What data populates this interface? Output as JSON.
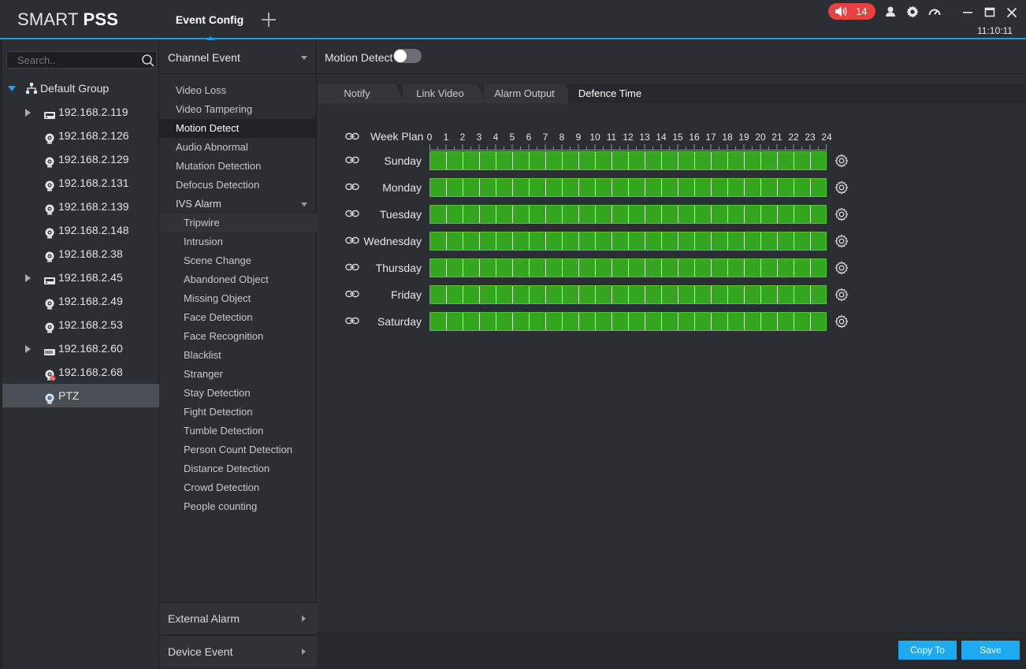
{
  "app": {
    "logo_light": "SMART",
    "logo_bold": "PSS",
    "active_tab": "Event Config",
    "alarm_count": "14",
    "clock": "11:10:11"
  },
  "search": {
    "placeholder": "Search.."
  },
  "tree": {
    "group": "Default Group",
    "devices": [
      {
        "label": "192.168.2.119",
        "type": "nvr",
        "expandable": true
      },
      {
        "label": "192.168.2.126",
        "type": "camera",
        "expandable": false
      },
      {
        "label": "192.168.2.129",
        "type": "camera",
        "expandable": false
      },
      {
        "label": "192.168.2.131",
        "type": "camera",
        "expandable": false
      },
      {
        "label": "192.168.2.139",
        "type": "camera",
        "expandable": false
      },
      {
        "label": "192.168.2.148",
        "type": "camera",
        "expandable": false
      },
      {
        "label": "192.168.2.38",
        "type": "camera",
        "expandable": false
      },
      {
        "label": "192.168.2.45",
        "type": "nvr",
        "expandable": true
      },
      {
        "label": "192.168.2.49",
        "type": "camera",
        "expandable": false
      },
      {
        "label": "192.168.2.53",
        "type": "camera",
        "expandable": false
      },
      {
        "label": "192.168.2.60",
        "type": "nvr2",
        "expandable": true
      },
      {
        "label": "192.168.2.68",
        "type": "camera-offline",
        "expandable": false
      },
      {
        "label": "PTZ",
        "type": "camera-selected",
        "expandable": false,
        "selected": true
      }
    ]
  },
  "events": {
    "header": "Channel Event",
    "items": [
      {
        "label": "Video Loss",
        "kind": "item"
      },
      {
        "label": "Video Tampering",
        "kind": "item"
      },
      {
        "label": "Motion Detect",
        "kind": "item",
        "selected": true
      },
      {
        "label": "Audio Abnormal",
        "kind": "item"
      },
      {
        "label": "Mutation Detection",
        "kind": "item"
      },
      {
        "label": "Defocus Detection",
        "kind": "item"
      },
      {
        "label": "IVS Alarm",
        "kind": "group"
      },
      {
        "label": "Tripwire",
        "kind": "sub"
      },
      {
        "label": "Intrusion",
        "kind": "sub"
      },
      {
        "label": "Scene Change",
        "kind": "sub"
      },
      {
        "label": "Abandoned Object",
        "kind": "sub"
      },
      {
        "label": "Missing Object",
        "kind": "sub"
      },
      {
        "label": "Face Detection",
        "kind": "sub"
      },
      {
        "label": "Face Recognition",
        "kind": "sub"
      },
      {
        "label": "Blacklist",
        "kind": "sub"
      },
      {
        "label": "Stranger",
        "kind": "sub"
      },
      {
        "label": "Stay Detection",
        "kind": "sub"
      },
      {
        "label": "Fight Detection",
        "kind": "sub"
      },
      {
        "label": "Tumble Detection",
        "kind": "sub"
      },
      {
        "label": "Person Count Detection",
        "kind": "sub"
      },
      {
        "label": "Distance Detection",
        "kind": "sub"
      },
      {
        "label": "Crowd Detection",
        "kind": "sub"
      },
      {
        "label": "People counting",
        "kind": "sub"
      }
    ],
    "external_alarm": "External Alarm",
    "device_event": "Device Event"
  },
  "content": {
    "title": "Motion Detect",
    "toggle_on": false,
    "tabs": [
      "Notify",
      "Link Video",
      "Alarm Output",
      "Defence Time"
    ],
    "active_tab": "Defence Time",
    "week_plan_label": "Week Plan",
    "hours": [
      "0",
      "1",
      "2",
      "3",
      "4",
      "5",
      "6",
      "7",
      "8",
      "9",
      "10",
      "11",
      "12",
      "13",
      "14",
      "15",
      "16",
      "17",
      "18",
      "19",
      "20",
      "21",
      "22",
      "23",
      "24"
    ],
    "days": [
      "Sunday",
      "Monday",
      "Tuesday",
      "Wednesday",
      "Thursday",
      "Friday",
      "Saturday"
    ],
    "copy_to": "Copy To",
    "save": "Save"
  },
  "colors": {
    "accent": "#1eaaf1",
    "schedule_fill": "#33a51f",
    "alarm_badge": "#e8413f"
  }
}
